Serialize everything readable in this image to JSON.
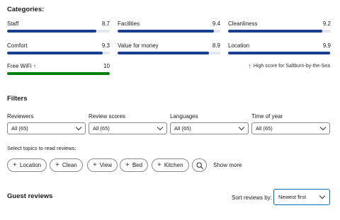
{
  "categories_title": "Categories:",
  "categories": [
    {
      "label": "Staff",
      "score": "8.7",
      "value": 8.7
    },
    {
      "label": "Facilities",
      "score": "9.4",
      "value": 9.4
    },
    {
      "label": "Cleanliness",
      "score": "9.2",
      "value": 9.2
    },
    {
      "label": "Comfort",
      "score": "9.3",
      "value": 9.3
    },
    {
      "label": "Value for money",
      "score": "8.9",
      "value": 8.9
    },
    {
      "label": "Location",
      "score": "9.9",
      "value": 9.9
    },
    {
      "label": "Free WiFi",
      "score": "10",
      "value": 10,
      "arrow": "↑"
    }
  ],
  "max_score": 10,
  "colors": {
    "bar": "#1a3f91",
    "bar_high": "#008009",
    "accent": "#0071c2"
  },
  "high_score_note": "High score for Saltburn-by-the-Sea",
  "high_score_icon": "↑",
  "filters_title": "Filters",
  "filters": [
    {
      "label": "Reviewers",
      "value": "All (65)"
    },
    {
      "label": "Review scores",
      "value": "All (65)"
    },
    {
      "label": "Languages",
      "value": "All (65)"
    },
    {
      "label": "Time of year",
      "value": "All (65)"
    }
  ],
  "topics_label": "Select topics to read reviews:",
  "topics": [
    "Location",
    "Clean",
    "View",
    "Bed",
    "Kitchen"
  ],
  "show_more": "Show more",
  "guest_reviews_title": "Guest reviews",
  "sort_label": "Sort reviews by:",
  "sort_value": "Newest first",
  "icons": {
    "plus": "plus-icon",
    "search": "search-icon",
    "chevron": "chevron-down-icon"
  }
}
